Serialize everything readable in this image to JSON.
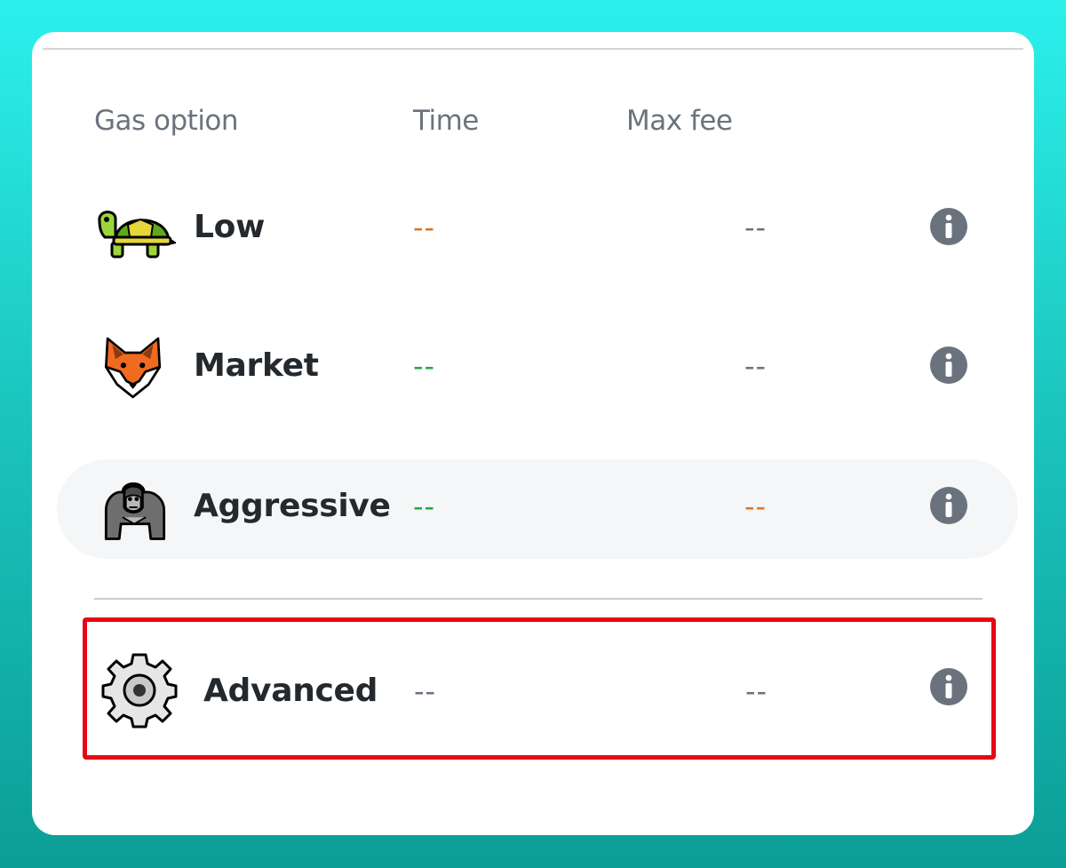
{
  "headers": {
    "gas_option": "Gas option",
    "time": "Time",
    "max_fee": "Max fee"
  },
  "options": [
    {
      "name": "Low",
      "time": "--",
      "max_fee": "--",
      "icon": "turtle-icon",
      "time_color": "#d9772a",
      "fee_color": "#6a737d"
    },
    {
      "name": "Market",
      "time": "--",
      "max_fee": "--",
      "icon": "fox-icon",
      "time_color": "#28a745",
      "fee_color": "#6a737d"
    },
    {
      "name": "Aggressive",
      "time": "--",
      "max_fee": "--",
      "icon": "gorilla-icon",
      "time_color": "#28a745",
      "fee_color": "#d9772a"
    }
  ],
  "advanced": {
    "name": "Advanced",
    "time": "--",
    "max_fee": "--",
    "icon": "gear-icon",
    "time_color": "#6a737d",
    "fee_color": "#6a737d"
  },
  "colors": {
    "highlight_border": "#e50914",
    "info_icon": "#6a737d",
    "text_primary": "#24292e",
    "text_secondary": "#6a737d",
    "dash_orange": "#d9772a",
    "dash_green": "#28a745"
  }
}
